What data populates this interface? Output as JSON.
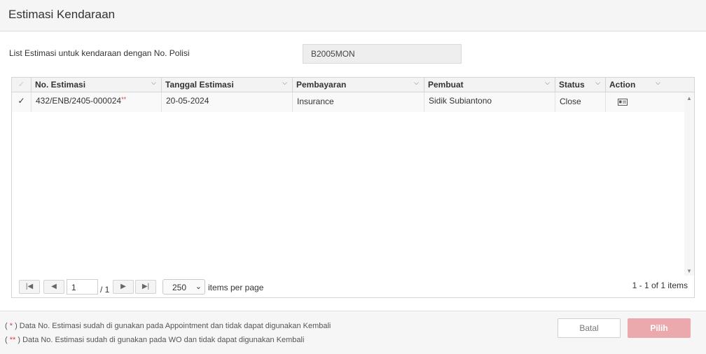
{
  "header": {
    "title": "Estimasi Kendaraan"
  },
  "plate": {
    "label": "List Estimasi untuk kendaraan dengan No. Polisi",
    "value": "B2005MON"
  },
  "grid": {
    "columns": [
      "No. Estimasi",
      "Tanggal Estimasi",
      "Pembayaran",
      "Pembuat",
      "Status",
      "Action"
    ],
    "rows": [
      {
        "no_estimasi": "432/ENB/2405-000024",
        "marker": "**",
        "tanggal": "20-05-2024",
        "pembayaran": "Insurance",
        "pembuat": "Sidik Subiantono",
        "status": "Close",
        "action_icon": "id-card-icon"
      }
    ]
  },
  "pager": {
    "page": "1",
    "of": "/ 1",
    "page_size": "250",
    "per_page_label": "items per page",
    "info": "1 - 1 of 1 items"
  },
  "footer": {
    "note1_open": "( ",
    "note1_mark": "*",
    "note1_text": " ) Data No. Estimasi sudah di gunakan pada Appointment dan tidak dapat digunakan Kembali",
    "note2_open": "( ",
    "note2_mark": "**",
    "note2_text": " ) Data No. Estimasi sudah di gunakan pada WO dan tidak dapat digunakan Kembali",
    "batal_label": "Batal",
    "pilih_label": "Pilih"
  },
  "colors": {
    "accent_red": "#e03a3a",
    "pilih_bg": "#eba9ae"
  }
}
